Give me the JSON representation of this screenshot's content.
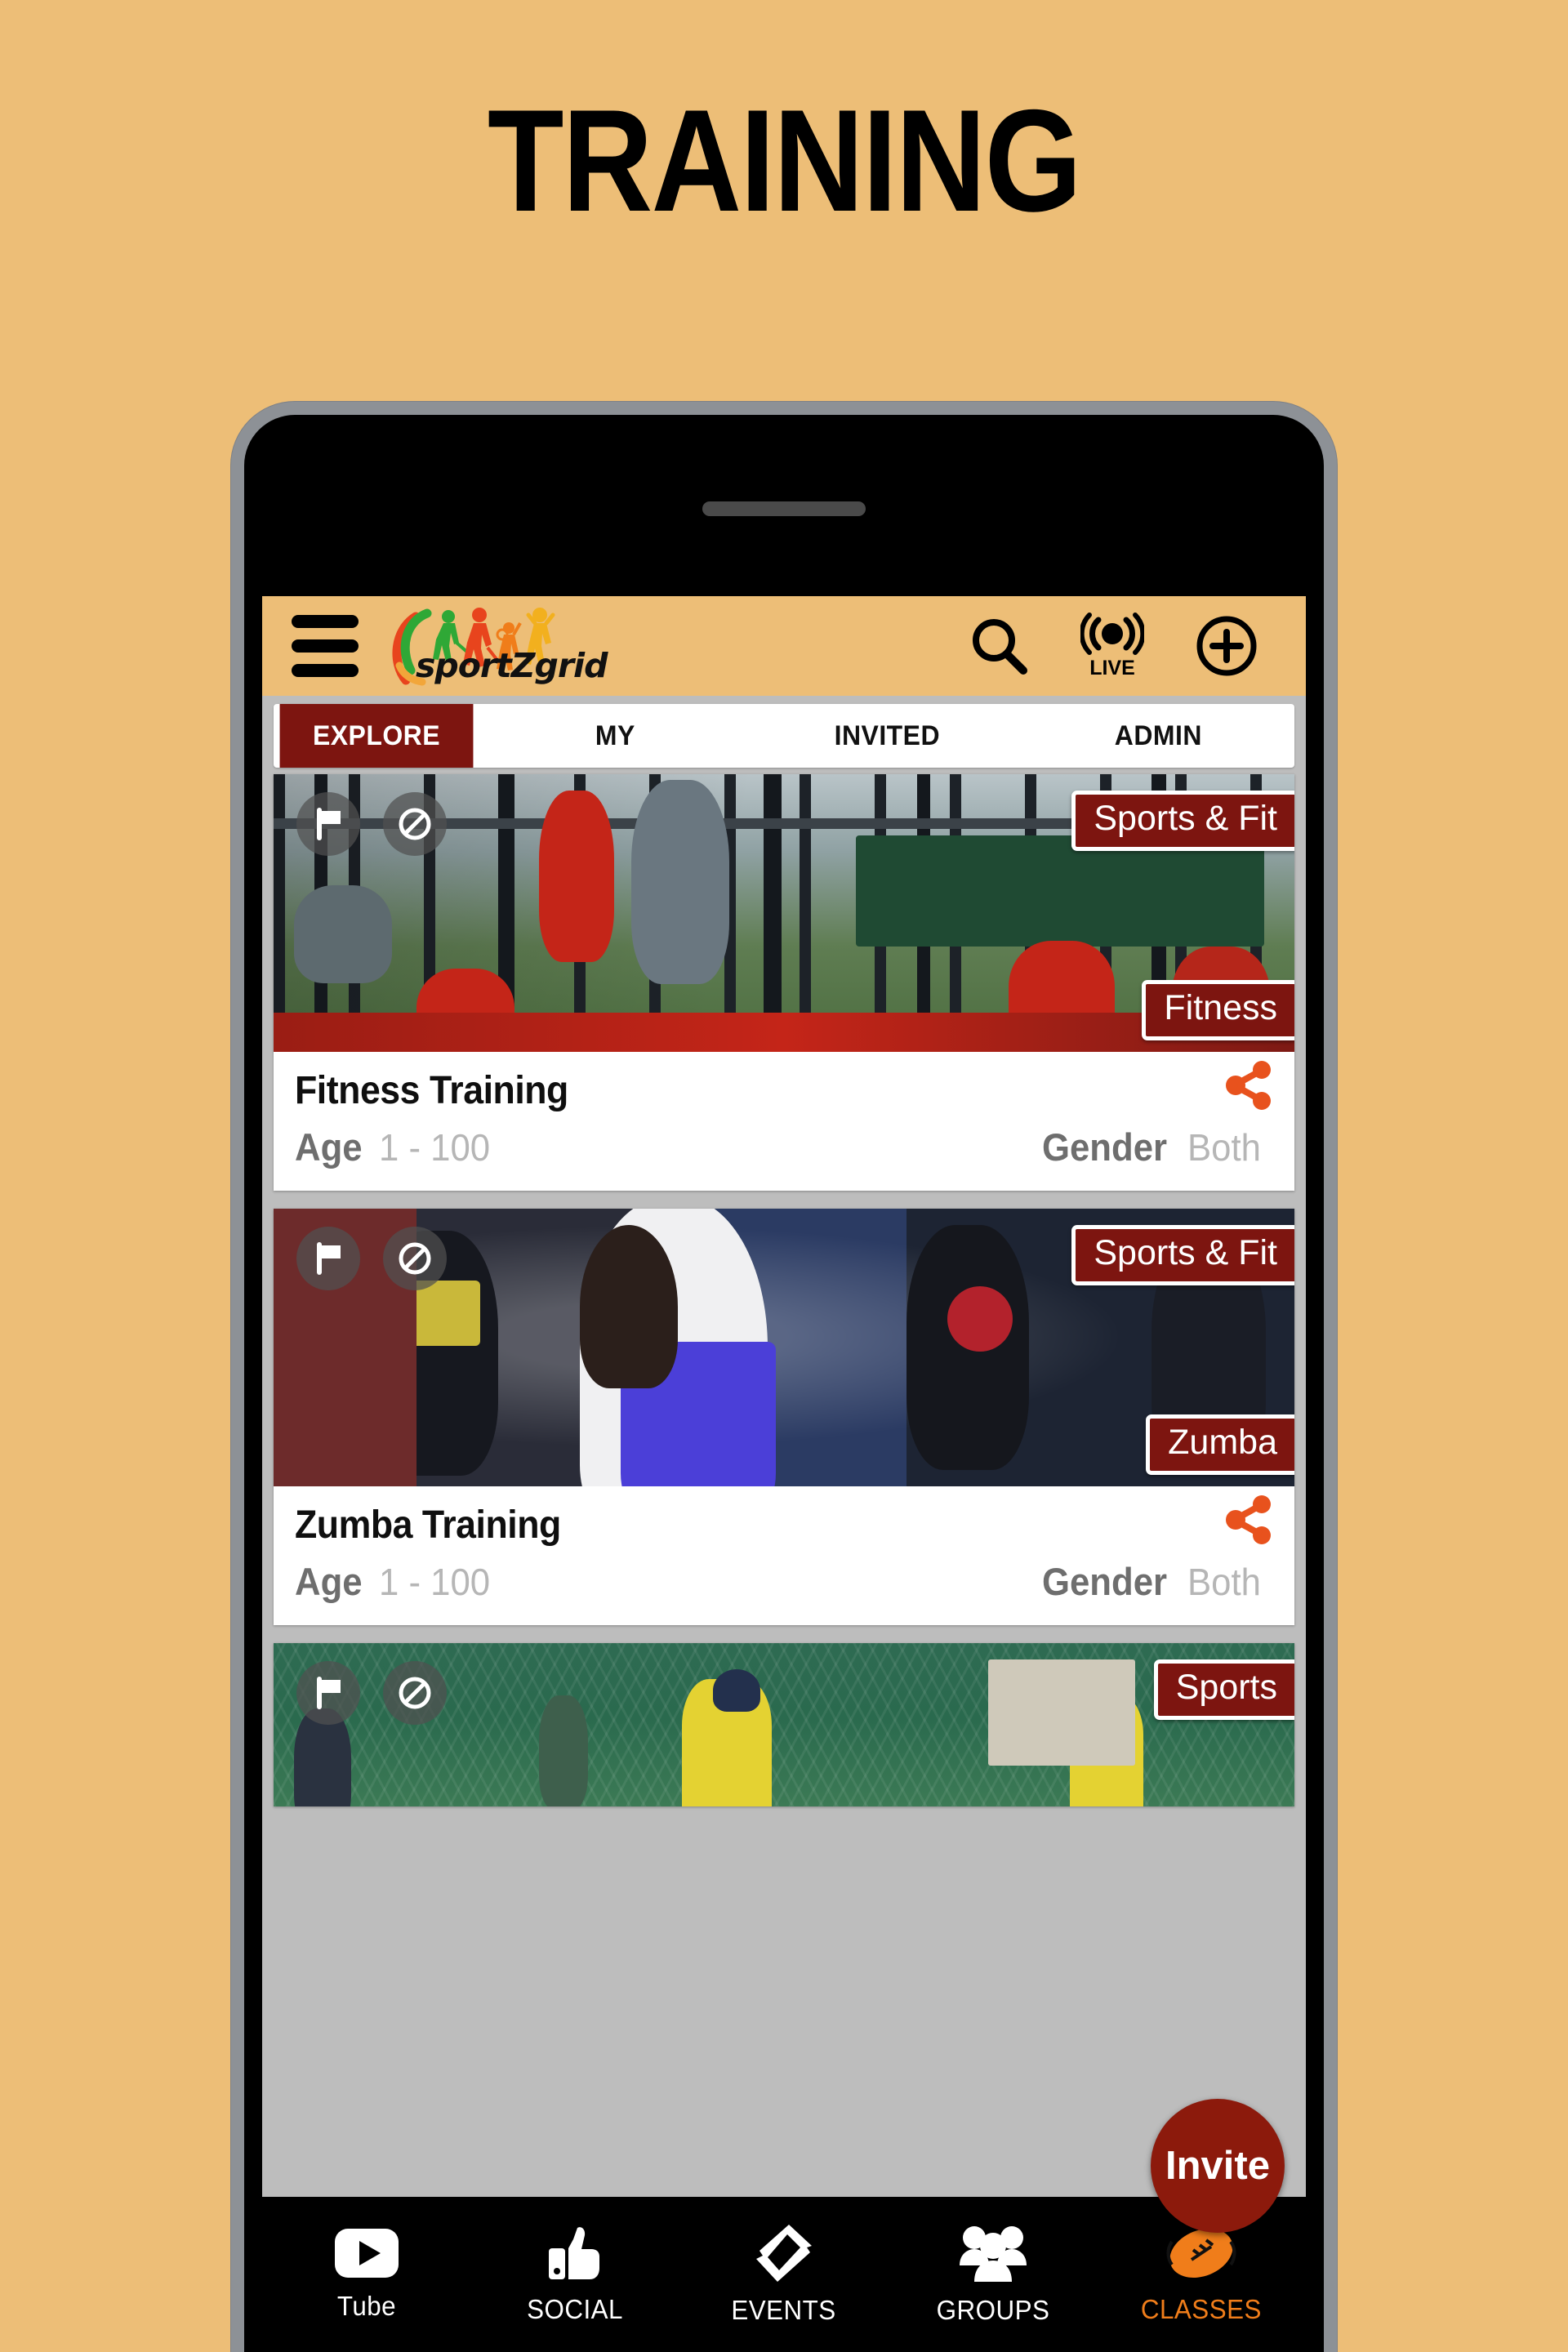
{
  "poster": {
    "title": "TRAINING",
    "background_color": "#edbe77"
  },
  "app": {
    "brand_name": "sportZgrid",
    "accent_color": "#7d1510",
    "header_bg": "#edbe77",
    "header": {
      "menu_icon": "hamburger-menu-icon",
      "search_icon": "search-icon",
      "live_icon": "live-broadcast-icon",
      "live_label": "LIVE",
      "add_icon": "plus-circle-icon"
    },
    "tabs": [
      {
        "label": "EXPLORE",
        "active": true
      },
      {
        "label": "MY",
        "active": false
      },
      {
        "label": "INVITED",
        "active": false
      },
      {
        "label": "ADMIN",
        "active": false
      }
    ],
    "cards": [
      {
        "title": "Fitness Training",
        "category_badge": "Sports & Fit",
        "sub_badge": "Fitness",
        "age_label": "Age",
        "age_value": "1 - 100",
        "gender_label": "Gender",
        "gender_value": "Both",
        "flag_icon": "flag-icon",
        "block_icon": "block-icon",
        "share_icon": "share-icon",
        "image_alt": "outdoor-gym-pullup-training"
      },
      {
        "title": "Zumba Training",
        "category_badge": "Sports & Fit",
        "sub_badge": "Zumba",
        "age_label": "Age",
        "age_value": "1 - 100",
        "gender_label": "Gender",
        "gender_value": "Both",
        "flag_icon": "flag-icon",
        "block_icon": "block-icon",
        "share_icon": "share-icon",
        "image_alt": "zumba-dance-class"
      },
      {
        "title": "",
        "category_badge": "Sports",
        "sub_badge": "",
        "age_label": "",
        "age_value": "",
        "gender_label": "",
        "gender_value": "",
        "flag_icon": "flag-icon",
        "block_icon": "block-icon",
        "share_icon": "share-icon",
        "image_alt": "cricket-net-practice"
      }
    ],
    "fab": {
      "label": "Invite"
    },
    "bottom_nav": [
      {
        "label": "Tube",
        "icon": "play-button-icon",
        "active": false
      },
      {
        "label": "SOCIAL",
        "icon": "thumbs-up-icon",
        "active": false
      },
      {
        "label": "EVENTS",
        "icon": "ticket-icon",
        "active": false
      },
      {
        "label": "GROUPS",
        "icon": "people-group-icon",
        "active": false
      },
      {
        "label": "CLASSES",
        "icon": "football-icon",
        "active": true
      }
    ]
  }
}
